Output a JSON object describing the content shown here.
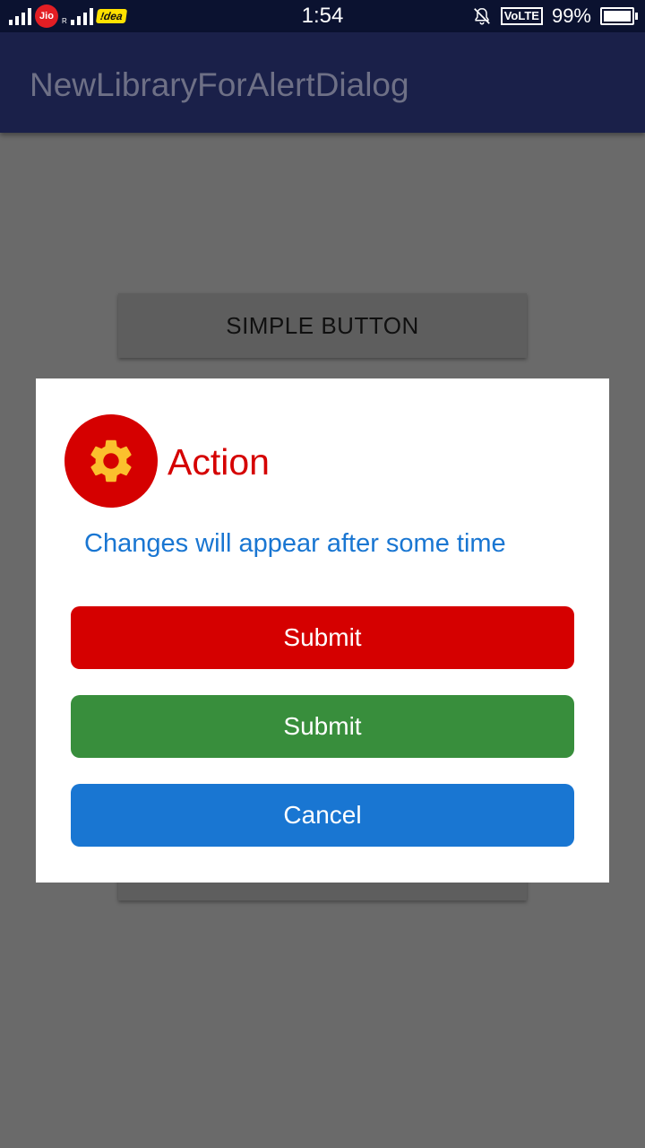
{
  "status_bar": {
    "carrier1": "Jio",
    "carrier1_sub": "R",
    "carrier2": "!dea",
    "time": "1:54",
    "volte": "VoLTE",
    "battery_percent": "99%",
    "battery_level": 0.99,
    "icons": [
      "signal-icon",
      "jio-icon",
      "idea-icon",
      "bell-muted-icon",
      "volte-icon",
      "battery-icon"
    ]
  },
  "app_bar": {
    "title": "NewLibraryForAlertDialog"
  },
  "background": {
    "simple_button_label": "SIMPLE BUTTON"
  },
  "dialog": {
    "icon": "gear-icon",
    "title": "Action",
    "message": "Changes will appear after some time",
    "buttons": [
      {
        "label": "Submit",
        "color": "#d50000"
      },
      {
        "label": "Submit",
        "color": "#388e3c"
      },
      {
        "label": "Cancel",
        "color": "#1976d2"
      }
    ]
  },
  "colors": {
    "accent_red": "#d50000",
    "accent_green": "#388e3c",
    "accent_blue": "#1976d2",
    "icon_gear": "#fbc02d",
    "app_bar": "#1a2049"
  }
}
